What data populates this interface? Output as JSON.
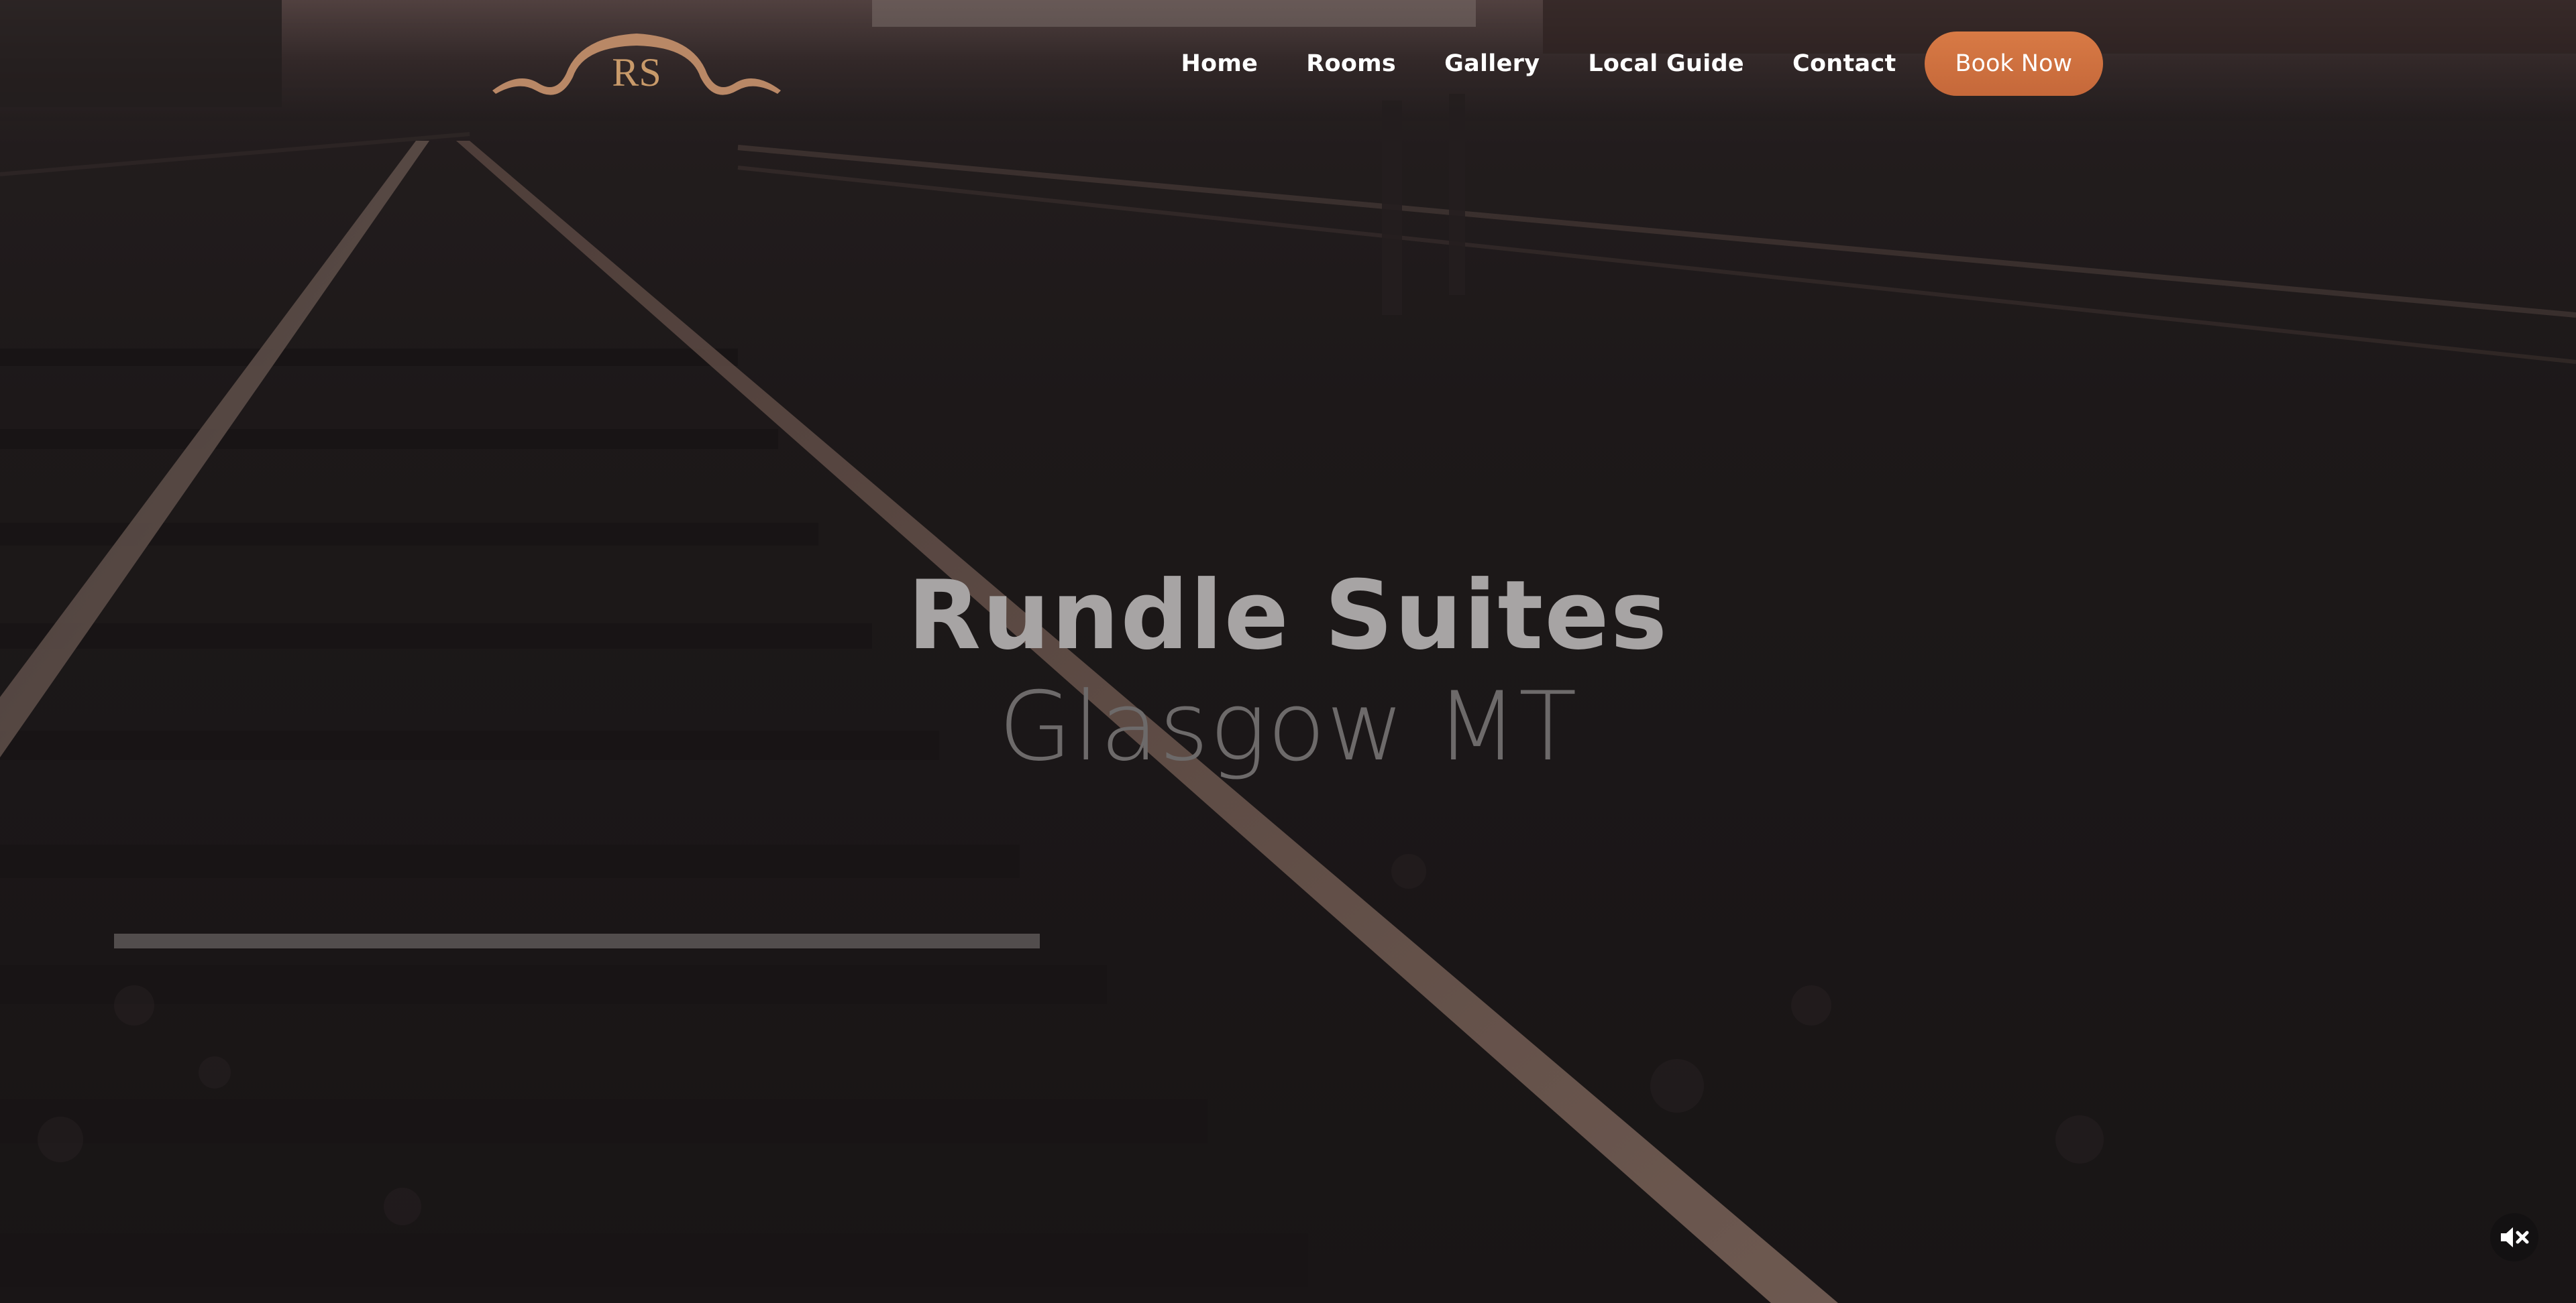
{
  "brand": {
    "logo_letters": "RS",
    "logo_color": "#b98866"
  },
  "nav": {
    "items": [
      {
        "label": "Home"
      },
      {
        "label": "Rooms"
      },
      {
        "label": "Gallery"
      },
      {
        "label": "Local Guide"
      },
      {
        "label": "Contact"
      }
    ],
    "book_label": "Book Now"
  },
  "hero": {
    "title": "Rundle Suites",
    "subtitle": "Glasgow MT"
  },
  "media": {
    "mute_icon": "speaker-muted-icon"
  },
  "colors": {
    "accent": "#d0713f",
    "nav_text": "#ffffff",
    "background": "#1c1819"
  }
}
